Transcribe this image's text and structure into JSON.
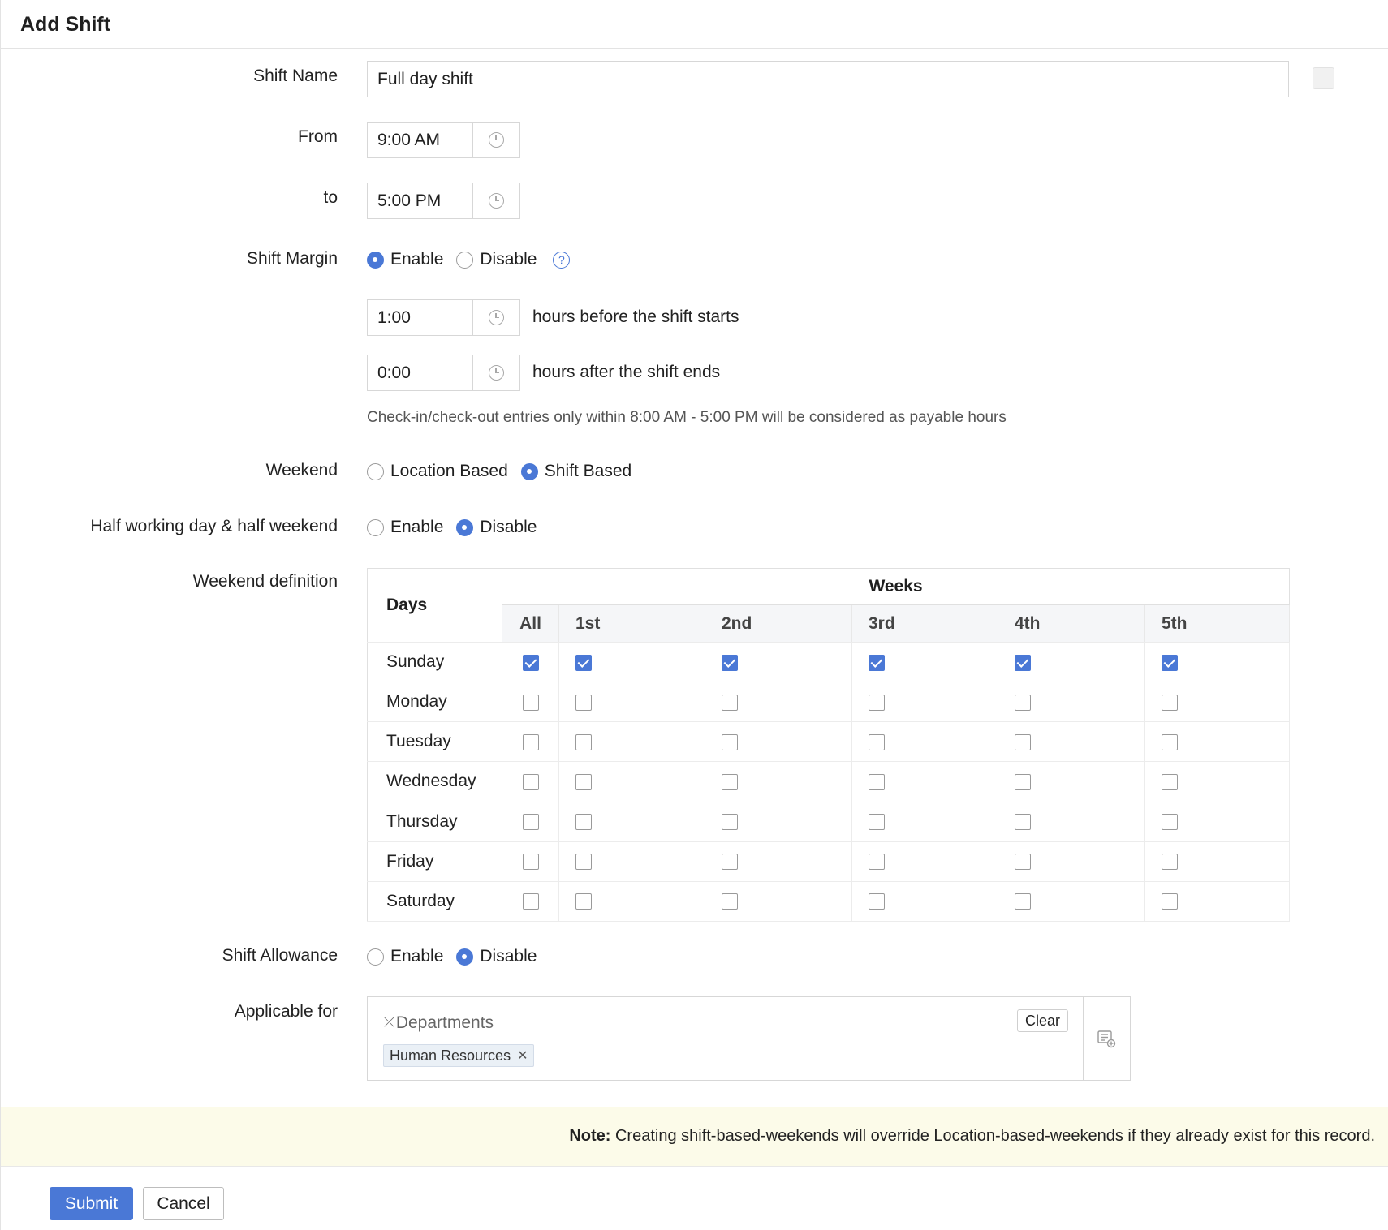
{
  "header": {
    "title": "Add Shift"
  },
  "form": {
    "shift_name": {
      "label": "Shift Name",
      "value": "Full day shift"
    },
    "from": {
      "label": "From",
      "value": "9:00 AM",
      "icon": "clock-icon"
    },
    "to": {
      "label": "to",
      "value": "5:00 PM",
      "icon": "clock-icon"
    },
    "shift_margin": {
      "label": "Shift Margin",
      "options": [
        "Enable",
        "Disable"
      ],
      "selected": "Enable",
      "help_icon": "question-icon",
      "before": {
        "value": "1:00",
        "text": "hours before the shift starts"
      },
      "after": {
        "value": "0:00",
        "text": "hours after the shift ends"
      },
      "hint": "Check-in/check-out entries only within 8:00 AM - 5:00 PM will be considered as payable hours"
    },
    "weekend": {
      "label": "Weekend",
      "options": [
        "Location Based",
        "Shift Based"
      ],
      "selected": "Shift Based"
    },
    "half_day": {
      "label": "Half working day & half weekend",
      "options": [
        "Enable",
        "Disable"
      ],
      "selected": "Disable"
    },
    "weekend_definition": {
      "label": "Weekend definition",
      "days_header": "Days",
      "weeks_header": "Weeks",
      "columns": [
        "All",
        "1st",
        "2nd",
        "3rd",
        "4th",
        "5th"
      ],
      "rows": [
        {
          "day": "Sunday",
          "checks": [
            true,
            true,
            true,
            true,
            true,
            true
          ]
        },
        {
          "day": "Monday",
          "checks": [
            false,
            false,
            false,
            false,
            false,
            false
          ]
        },
        {
          "day": "Tuesday",
          "checks": [
            false,
            false,
            false,
            false,
            false,
            false
          ]
        },
        {
          "day": "Wednesday",
          "checks": [
            false,
            false,
            false,
            false,
            false,
            false
          ]
        },
        {
          "day": "Thursday",
          "checks": [
            false,
            false,
            false,
            false,
            false,
            false
          ]
        },
        {
          "day": "Friday",
          "checks": [
            false,
            false,
            false,
            false,
            false,
            false
          ]
        },
        {
          "day": "Saturday",
          "checks": [
            false,
            false,
            false,
            false,
            false,
            false
          ]
        }
      ]
    },
    "shift_allowance": {
      "label": "Shift Allowance",
      "options": [
        "Enable",
        "Disable"
      ],
      "selected": "Disable"
    },
    "applicable_for": {
      "label": "Applicable for",
      "category": "Departments",
      "clear_label": "Clear",
      "tags": [
        "Human Resources"
      ]
    }
  },
  "note": {
    "prefix": "Note:",
    "text": " Creating shift-based-weekends will override Location-based-weekends if they already exist for this record."
  },
  "actions": {
    "submit": "Submit",
    "cancel": "Cancel"
  },
  "colors": {
    "accent": "#4a78d6",
    "note_bg": "#fcfbe9"
  }
}
